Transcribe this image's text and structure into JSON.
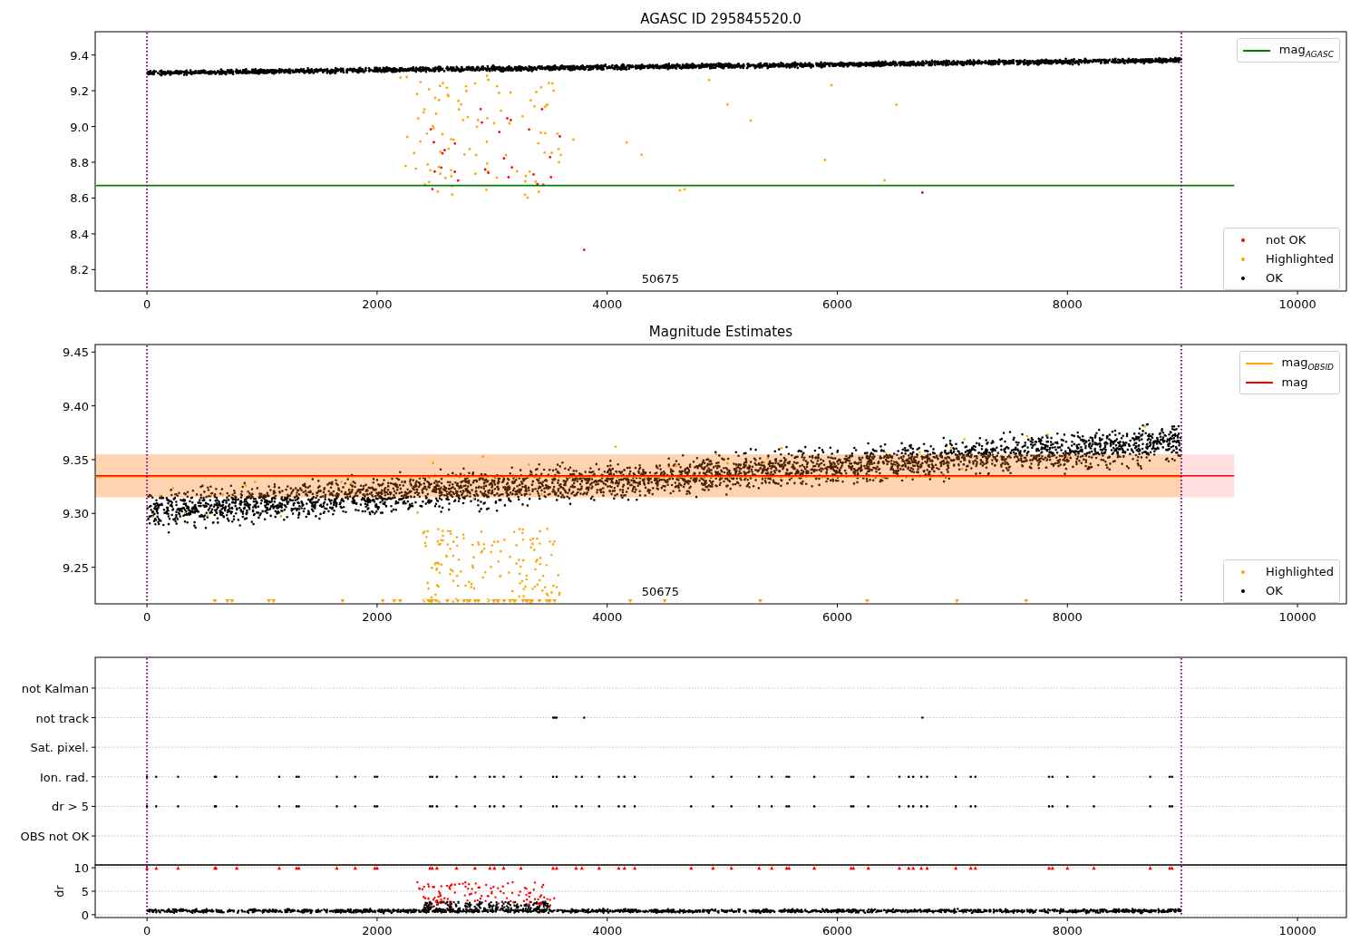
{
  "figure": {
    "panels": [
      {
        "kind": "agasc",
        "chart_data": {
          "type": "scatter",
          "title": "AGASC ID 295845520.0",
          "xlim": [
            -450,
            10425
          ],
          "ylim": [
            8.08,
            9.53
          ],
          "xticks": [
            0,
            2000,
            4000,
            6000,
            8000,
            10000
          ],
          "yticks": [
            8.2,
            8.4,
            8.6,
            8.8,
            {
              "value": 9,
              "label": "9.0"
            },
            9.2,
            9.4
          ],
          "ref_lines": [
            {
              "axis": "y",
              "value": 8.67,
              "color": "#008000"
            },
            {
              "axis": "x",
              "value": 0,
              "color": "#800080"
            },
            {
              "axis": "x",
              "value": 8990,
              "color": "#800080"
            }
          ],
          "annotations": [
            "50675"
          ]
        },
        "legends": [
          {
            "items": [
              {
                "label": "mag$_{AGASC}$",
                "kind": "line",
                "color": "#008000"
              }
            ]
          },
          {
            "items": [
              {
                "label": "not OK",
                "kind": "dot",
                "color": "#ff0000"
              },
              {
                "label": "Highlighted",
                "kind": "dot",
                "color": "#ffa500"
              },
              {
                "label": "OK",
                "kind": "dot",
                "color": "#000000"
              }
            ]
          }
        ]
      },
      {
        "kind": "estimates",
        "chart_data": {
          "type": "scatter",
          "title": "Magnitude Estimates",
          "xlim": [
            -450,
            10425
          ],
          "ylim": [
            9.216,
            9.457
          ],
          "xticks": [
            0,
            2000,
            4000,
            6000,
            8000,
            10000
          ],
          "yticks": [
            9.25,
            {
              "value": 9.3,
              "label": "9.30"
            },
            9.35,
            {
              "value": 9.4,
              "label": "9.40"
            },
            9.45
          ],
          "ref_lines": [
            {
              "axis": "y",
              "value": 9.334,
              "color": "#ffa500"
            },
            {
              "axis": "y",
              "value": 9.335,
              "color": "#ff0000"
            },
            {
              "axis": "x",
              "value": 0,
              "color": "#800080"
            },
            {
              "axis": "x",
              "value": 8990,
              "color": "#800080"
            }
          ],
          "annotations": [
            "50675"
          ]
        },
        "legends": [
          {
            "items": [
              {
                "label": "mag$_{OBSID}$",
                "kind": "line",
                "color": "#ffa500"
              },
              {
                "label": "mag",
                "kind": "line",
                "color": "#ff0000"
              }
            ]
          },
          {
            "items": [
              {
                "label": "Highlighted",
                "kind": "dot",
                "color": "#ffa500"
              },
              {
                "label": "OK",
                "kind": "dot",
                "color": "#000000"
              }
            ]
          }
        ]
      },
      {
        "kind": "flags",
        "chart_data": {
          "type": "scatter",
          "orientation": "horizontal",
          "xlim": [
            -450,
            10425
          ],
          "grid": true,
          "categories": [
            "not Kalman",
            "not track",
            "Sat. pixel.",
            "Ion. rad.",
            "dr > 5",
            "OBS not OK"
          ],
          "ref_lines": [
            {
              "axis": "x",
              "value": 0,
              "color": "#800080"
            },
            {
              "axis": "x",
              "value": 8990,
              "color": "#800080"
            }
          ]
        }
      },
      {
        "kind": "dr",
        "chart_data": {
          "type": "scatter",
          "ylabel": "dr",
          "grid": true,
          "xlim": [
            -450,
            10425
          ],
          "ylim": [
            -0.6,
            10.6
          ],
          "xticks": [
            0,
            2000,
            4000,
            6000,
            8000,
            10000
          ],
          "yticks": [
            0,
            5,
            10
          ],
          "ref_lines": [
            {
              "axis": "x",
              "value": 0,
              "color": "#800080"
            },
            {
              "axis": "x",
              "value": 8990,
              "color": "#800080"
            }
          ]
        }
      }
    ]
  }
}
